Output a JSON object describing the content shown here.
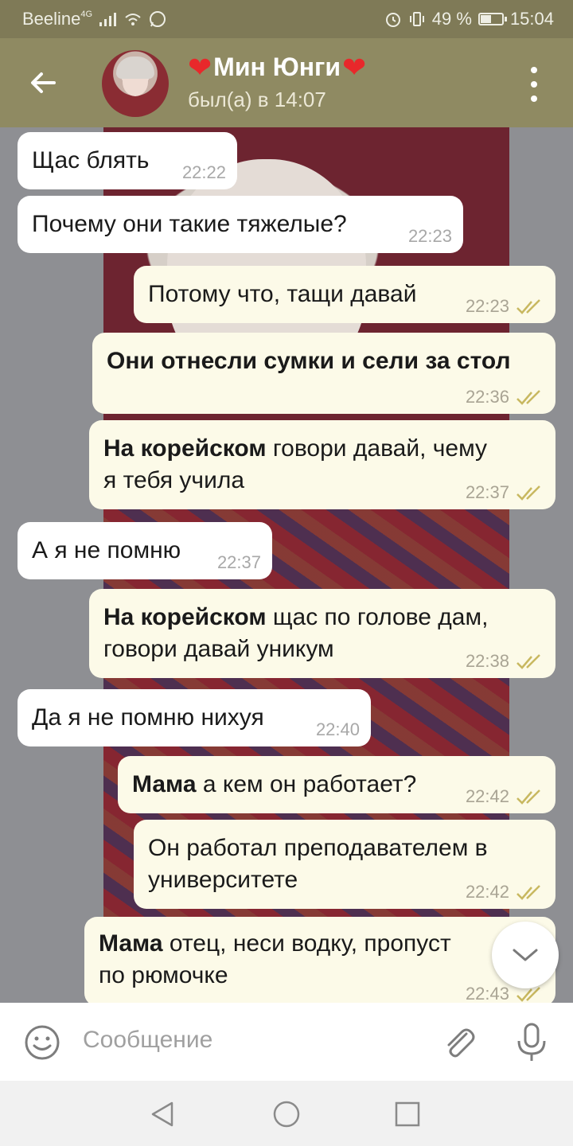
{
  "status_bar": {
    "carrier": "Beeline",
    "network": "4G",
    "battery": "49 %",
    "battery_level": 0.49,
    "time": "15:04"
  },
  "header": {
    "contact_name": "Мин Юнги",
    "last_seen": "был(а) в 14:07"
  },
  "messages": [
    {
      "dir": "in",
      "text": "Щас блять",
      "time": "22:22"
    },
    {
      "dir": "in",
      "text": "Почему они такие тяжелые?",
      "time": "22:23"
    },
    {
      "dir": "out",
      "text": "Потому что, тащи давай",
      "time": "22:23"
    },
    {
      "dir": "out",
      "bold": "Они отнесли сумки и сели за стол",
      "text": "",
      "time": "22:36"
    },
    {
      "dir": "out",
      "bold": "На корейском",
      "text": " говори давай, чему\nя тебя учила",
      "time": "22:37"
    },
    {
      "dir": "in",
      "text": "А я не помню",
      "time": "22:37"
    },
    {
      "dir": "out",
      "bold": "На корейском",
      "text": " щас по голове дам,\nговори давай уникум",
      "time": "22:38"
    },
    {
      "dir": "in",
      "text": "Да я не помню нихуя",
      "time": "22:40"
    },
    {
      "dir": "out",
      "bold": "Мама",
      "text": " а кем он работает?",
      "time": "22:42"
    },
    {
      "dir": "out",
      "text": "Он работал преподавателем в\nуниверситете",
      "time": "22:42"
    },
    {
      "dir": "out",
      "bold": "Мама",
      "text": " отец, неси водку, пропуст\nпо рюмочке",
      "time": "22:43"
    }
  ],
  "input": {
    "placeholder": "Сообщение"
  },
  "colors": {
    "header": "#8f8a62",
    "status_bar": "#7f7a57",
    "outgoing_bubble": "#fcfae8",
    "incoming_bubble": "#ffffff",
    "heart": "#e8282b",
    "read_ticks": "#c8b860"
  },
  "icons": [
    "back-arrow-icon",
    "avatar",
    "heart-icon",
    "more-vert-icon",
    "double-check-icon",
    "chevron-down-icon",
    "emoji-icon",
    "paperclip-icon",
    "microphone-icon",
    "nav-back-icon",
    "nav-home-icon",
    "nav-recents-icon"
  ]
}
